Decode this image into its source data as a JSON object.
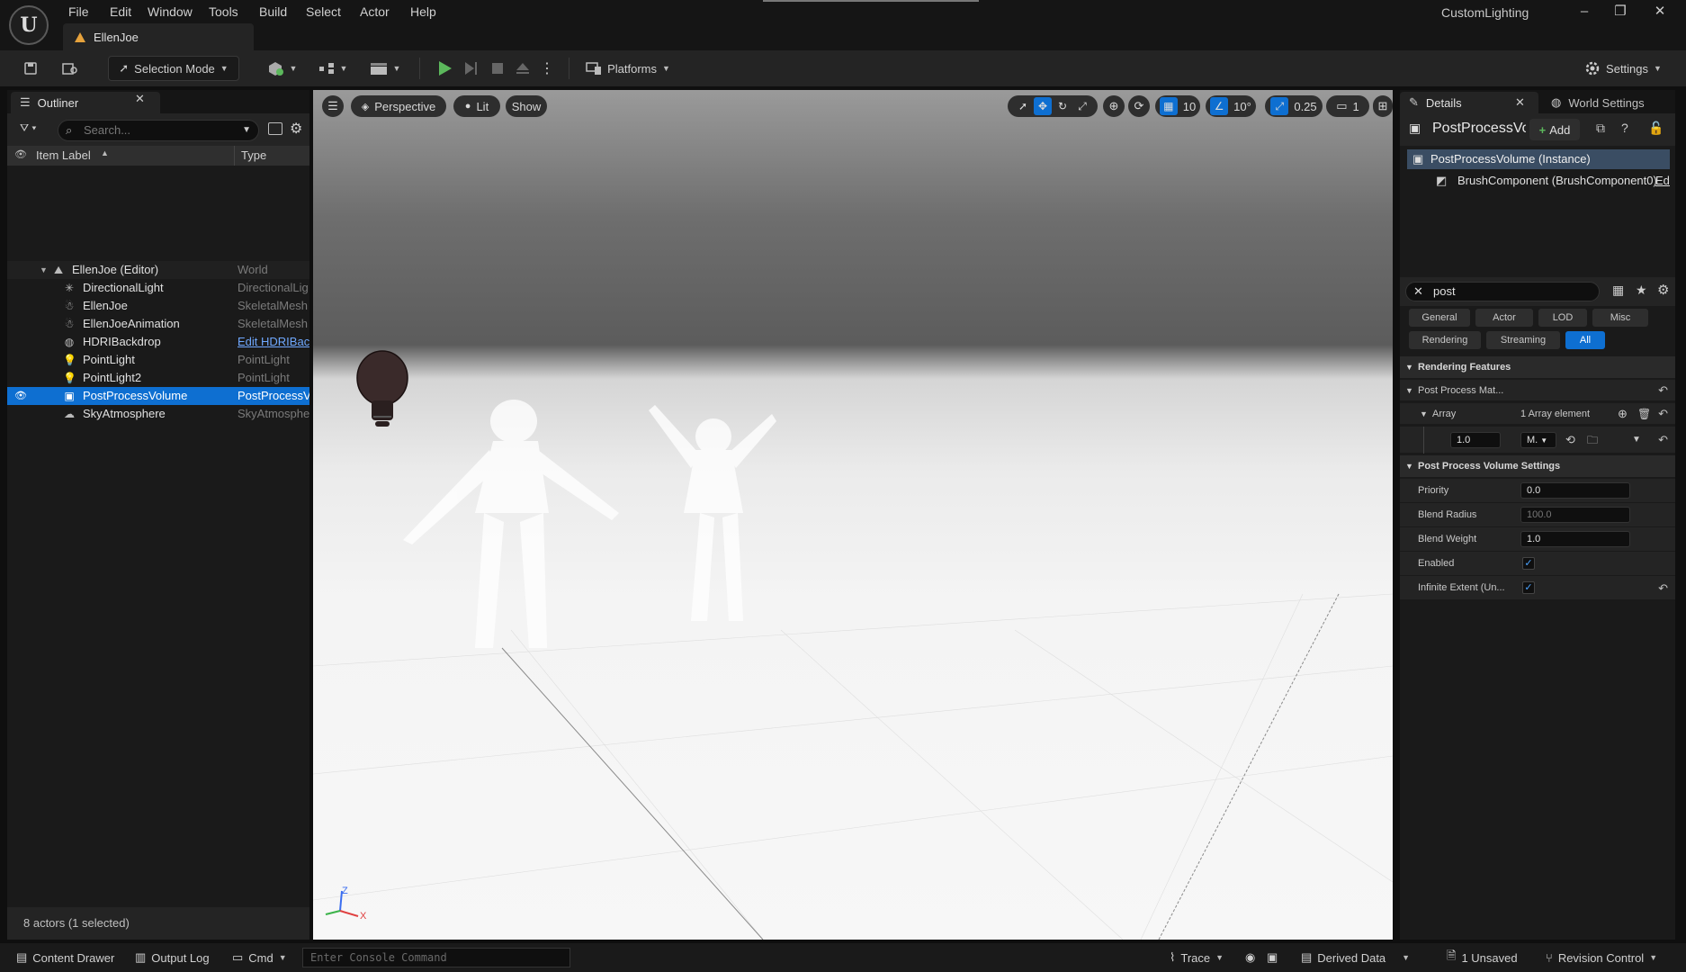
{
  "menu": [
    "File",
    "Edit",
    "Window",
    "Tools",
    "Build",
    "Select",
    "Actor",
    "Help"
  ],
  "level_tab": "EllenJoe",
  "project_name": "CustomLighting",
  "window_controls": {
    "minimize": "–",
    "restore": "❐",
    "close": "✕"
  },
  "toolbar": {
    "selection_mode": "Selection Mode",
    "platforms": "Platforms",
    "settings": "Settings"
  },
  "outliner": {
    "tab_label": "Outliner",
    "search_placeholder": "Search...",
    "col_label": "Item Label",
    "col_type": "Type",
    "rows": [
      {
        "label": "EllenJoe (Editor)",
        "type": "World"
      },
      {
        "label": "DirectionalLight",
        "type": "DirectionalLig"
      },
      {
        "label": "EllenJoe",
        "type": "SkeletalMesh"
      },
      {
        "label": "EllenJoeAnimation",
        "type": "SkeletalMesh"
      },
      {
        "label": "HDRIBackdrop",
        "type": "Edit HDRIBacl"
      },
      {
        "label": "PointLight",
        "type": "PointLight"
      },
      {
        "label": "PointLight2",
        "type": "PointLight"
      },
      {
        "label": "PostProcessVolume",
        "type": "PostProcessV"
      },
      {
        "label": "SkyAtmosphere",
        "type": "SkyAtmosphe"
      }
    ],
    "status": "8 actors (1 selected)"
  },
  "viewport": {
    "perspective": "Perspective",
    "lit": "Lit",
    "show": "Show",
    "grid_snap": "10",
    "rotation_snap": "10°",
    "scale_snap": "0.25",
    "camera_speed": "1",
    "axis_z": "Z",
    "axis_x": "X"
  },
  "details": {
    "tab_label": "Details",
    "world_settings_tab": "World Settings",
    "actor_name": "PostProcessVolume",
    "add_label": "Add",
    "root_component": "PostProcessVolume (Instance)",
    "child_component": "BrushComponent (BrushComponent0)",
    "child_edit": "Edi",
    "filter_value": "post",
    "categories_row1": [
      "General",
      "Actor",
      "LOD",
      "Misc"
    ],
    "categories_row2": [
      "Rendering",
      "Streaming",
      "All"
    ],
    "section_rendering": "Rendering Features",
    "pp_materials": "Post Process Mat...",
    "array_label": "Array",
    "array_count": "1 Array element",
    "element_weight": "1.0",
    "element_asset": "M.",
    "section_volume": "Post Process Volume Settings",
    "props": [
      {
        "name": "Priority",
        "value": "0.0"
      },
      {
        "name": "Blend Radius",
        "value": "100.0"
      },
      {
        "name": "Blend Weight",
        "value": "1.0"
      },
      {
        "name": "Enabled",
        "value": ""
      },
      {
        "name": "Infinite Extent (Un...",
        "value": ""
      }
    ]
  },
  "bottom": {
    "content_drawer": "Content Drawer",
    "output_log": "Output Log",
    "cmd": "Cmd",
    "console_placeholder": "Enter Console Command",
    "trace": "Trace",
    "derived_data": "Derived Data",
    "unsaved": "1 Unsaved",
    "revision_control": "Revision Control"
  },
  "colors": {
    "accent": "#0e6fd1",
    "play": "#5cb85c",
    "panel": "#1a1a1a"
  }
}
